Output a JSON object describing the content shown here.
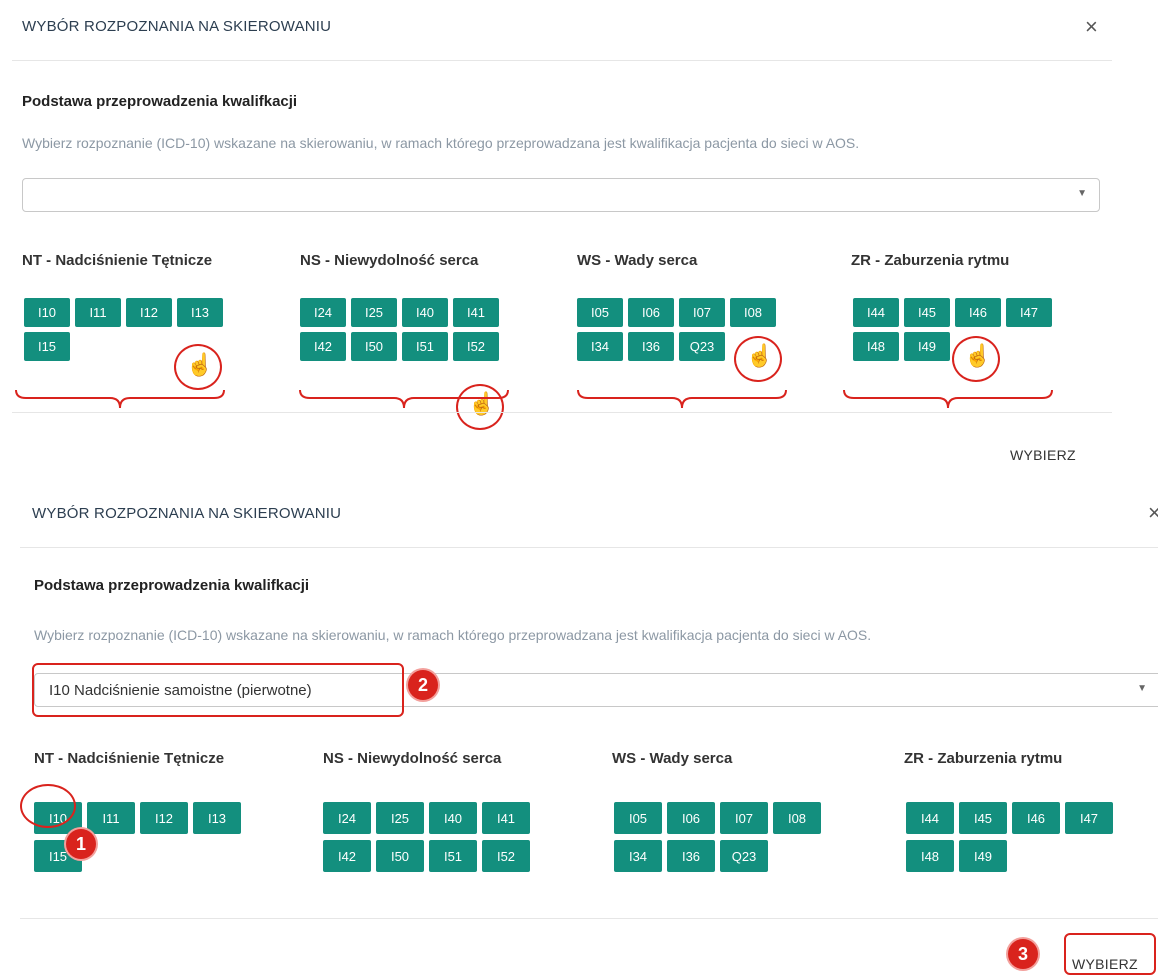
{
  "panel1": {
    "title": "WYBÓR ROZPOZNANIA NA SKIEROWANIU",
    "close": "×",
    "section_title": "Podstawa przeprowadzenia kwalifkacji",
    "hint": "Wybierz rozpoznanie (ICD-10) wskazane na skierowaniu, w ramach którego przeprowadzana jest kwalifikacja pacjenta do sieci w AOS.",
    "select_value": "",
    "caret": "▼",
    "action": "WYBIERZ"
  },
  "panel2": {
    "title": "WYBÓR ROZPOZNANIA NA SKIEROWANIU",
    "close": "×",
    "section_title": "Podstawa przeprowadzenia kwalifkacji",
    "hint": "Wybierz rozpoznanie (ICD-10) wskazane na skierowaniu, w ramach którego przeprowadzana jest kwalifikacja pacjenta do sieci w AOS.",
    "select_value": "I10 Nadciśnienie samoistne (pierwotne)",
    "caret": "▼",
    "action": "WYBIERZ"
  },
  "groups": [
    {
      "title": "NT - Nadciśnienie Tętnicze",
      "codes": [
        "I10",
        "I11",
        "I12",
        "I13",
        "I15"
      ]
    },
    {
      "title": "NS - Niewydolność serca",
      "codes": [
        "I24",
        "I25",
        "I40",
        "I41",
        "I42",
        "I50",
        "I51",
        "I52"
      ]
    },
    {
      "title": "WS - Wady serca",
      "codes": [
        "I05",
        "I06",
        "I07",
        "I08",
        "I34",
        "I36",
        "Q23"
      ]
    },
    {
      "title": "ZR - Zaburzenia rytmu",
      "codes": [
        "I44",
        "I45",
        "I46",
        "I47",
        "I48",
        "I49"
      ]
    }
  ],
  "annotations": {
    "step1": "1",
    "step2": "2",
    "step3": "3",
    "hand_icon": "☝",
    "color": "#d9231d"
  },
  "accent": "#138f7e"
}
